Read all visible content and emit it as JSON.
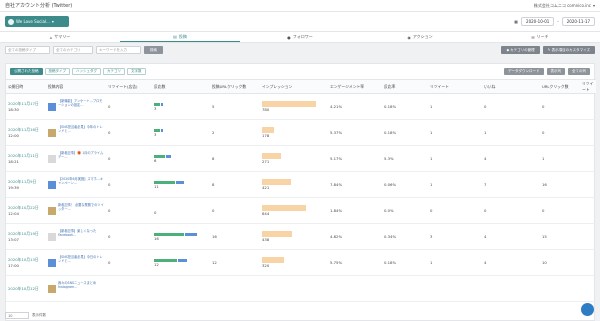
{
  "header": {
    "title": "自社アカウント分析 (Twitter)",
    "company": "株式会社コムニコ comnico.inc"
  },
  "account": {
    "name": "We Love Social..."
  },
  "dates": {
    "from": "2020-10-01",
    "sep": "-",
    "to": "2020-11-17"
  },
  "tabs": [
    {
      "label": "サマリー"
    },
    {
      "label": "投稿"
    },
    {
      "label": "フォロワー"
    },
    {
      "label": "アクション"
    },
    {
      "label": "リーチ"
    }
  ],
  "filters": {
    "f1": "全ての投稿タイプ",
    "f2": "全てのカテゴリ",
    "f3": "キーワードを入力",
    "search": "検索",
    "right1": "カテゴリの管理",
    "right2": "表示項目のカスタマイズ"
  },
  "panel_tabs": [
    "公開された投稿",
    "投稿タイプ",
    "ハッシュタグ",
    "カテゴリ",
    "文字数"
  ],
  "panel_actions": [
    "データダウンロード",
    "表示列",
    "全ての列"
  ],
  "columns": [
    "公開日時",
    "投稿内容",
    "リツイート(広告)",
    "反応数",
    "投稿URLクリック数",
    "インプレッション",
    "エンゲージメント率",
    "反応率",
    "リツイート",
    "いいね",
    "URLクリック数",
    "リツイート"
  ],
  "rows": [
    {
      "date": "2020年11月17日",
      "time": "18:30",
      "text": "【新機能】アンケート…プロモーションの設定…",
      "rt_ad": "0",
      "react": "3",
      "url": "5",
      "imp": "780",
      "eng": "4.21%",
      "rr": "0.18%",
      "rt": "1",
      "like": "0",
      "click": "0"
    },
    {
      "date": "2020年11月16日",
      "time": "12:00",
      "text": "【SNS担当者必見】今年のトレンドと…",
      "rt_ad": "0",
      "react": "3",
      "url": "2",
      "imp": "178",
      "eng": "5.37%",
      "rr": "0.18%",
      "rt": "1",
      "like": "1",
      "click": "0"
    },
    {
      "date": "2020年11月11日",
      "time": "18:21",
      "text": "【新着記事】🎁 1月のプライムデー…",
      "rt_ad": "0",
      "react": "6",
      "url": "8",
      "imp": "271",
      "eng": "5.17%",
      "rr": "5.3%",
      "rt": "1",
      "like": "4",
      "click": "1"
    },
    {
      "date": "2020年11月9日",
      "time": "19:39",
      "text": "【2020年6月実施】スマホ…キャンペーン…",
      "rt_ad": "0",
      "react": "11",
      "url": "8",
      "imp": "421",
      "eng": "7.84%",
      "rr": "0.06%",
      "rt": "1",
      "like": "7",
      "click": "16"
    },
    {
      "date": "2020年10月22日",
      "time": "12:04",
      "text": "新着記事！ 必要な業務でのツイッター…",
      "rt_ad": "0",
      "react": "0",
      "url": "0",
      "imp": "644",
      "eng": "1.84%",
      "rr": "0.0%",
      "rt": "0",
      "like": "0",
      "click": "0"
    },
    {
      "date": "2020年10月19日",
      "time": "13:07",
      "text": "【新着記事】楽しくなったFacebook…",
      "rt_ad": "0",
      "react": "16",
      "url": "16",
      "imp": "438",
      "eng": "4.82%",
      "rr": "0.34%",
      "rt": "3",
      "like": "4",
      "click": "15"
    },
    {
      "date": "2020年10月13日",
      "time": "17:00",
      "text": "【SNS担当者必見】今日のトレンドと…",
      "rt_ad": "0",
      "react": "12",
      "url": "12",
      "imp": "320",
      "eng": "5.75%",
      "rr": "0.18%",
      "rt": "1",
      "like": "4",
      "click": "10"
    },
    {
      "date": "2020年10月12日",
      "time": "",
      "text": "我々のSNSニュースまとめ Instagram…",
      "rt_ad": "",
      "react": "",
      "url": "",
      "imp": "",
      "eng": "",
      "rr": "",
      "rt": "",
      "like": "",
      "click": ""
    }
  ],
  "footer": {
    "label": "表示件数",
    "value": "10"
  }
}
